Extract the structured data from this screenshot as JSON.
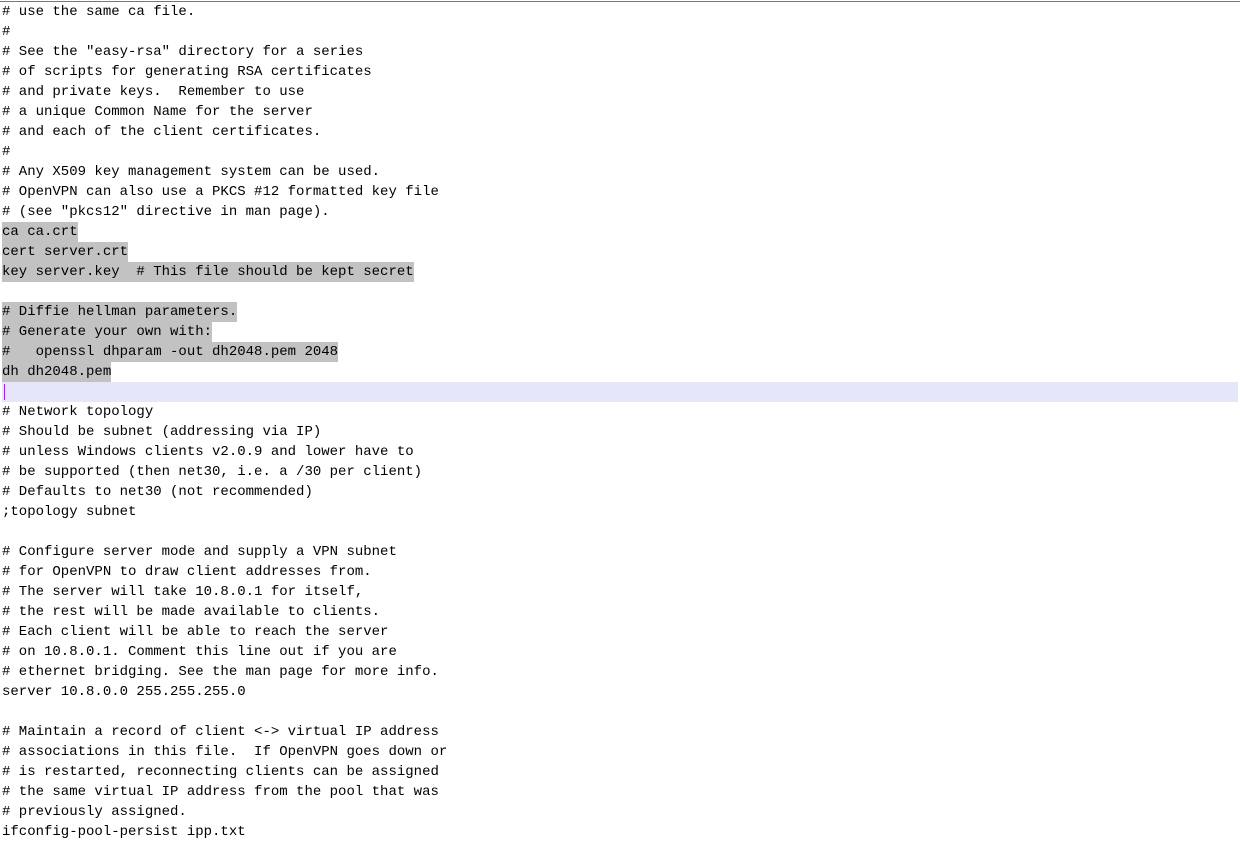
{
  "lines": [
    {
      "text": "# use the same ca file.",
      "sel": false
    },
    {
      "text": "#",
      "sel": false
    },
    {
      "text": "# See the \"easy-rsa\" directory for a series",
      "sel": false
    },
    {
      "text": "# of scripts for generating RSA certificates",
      "sel": false
    },
    {
      "text": "# and private keys.  Remember to use",
      "sel": false
    },
    {
      "text": "# a unique Common Name for the server",
      "sel": false
    },
    {
      "text": "# and each of the client certificates.",
      "sel": false
    },
    {
      "text": "#",
      "sel": false
    },
    {
      "text": "# Any X509 key management system can be used.",
      "sel": false
    },
    {
      "text": "# OpenVPN can also use a PKCS #12 formatted key file",
      "sel": false
    },
    {
      "text": "# (see \"pkcs12\" directive in man page).",
      "sel": false
    },
    {
      "text": "ca ca.crt",
      "sel": true
    },
    {
      "text": "cert server.crt",
      "sel": true
    },
    {
      "text": "key server.key  # This file should be kept secret",
      "sel": true
    },
    {
      "text": "",
      "sel": true
    },
    {
      "text": "# Diffie hellman parameters.",
      "sel": true
    },
    {
      "text": "# Generate your own with:",
      "sel": true
    },
    {
      "text": "#   openssl dhparam -out dh2048.pem 2048",
      "sel": true
    },
    {
      "text": "dh dh2048.pem",
      "sel": true
    },
    {
      "text": "",
      "sel": false,
      "cursor": true
    },
    {
      "text": "# Network topology",
      "sel": false
    },
    {
      "text": "# Should be subnet (addressing via IP)",
      "sel": false
    },
    {
      "text": "# unless Windows clients v2.0.9 and lower have to",
      "sel": false
    },
    {
      "text": "# be supported (then net30, i.e. a /30 per client)",
      "sel": false
    },
    {
      "text": "# Defaults to net30 (not recommended)",
      "sel": false
    },
    {
      "text": ";topology subnet",
      "sel": false
    },
    {
      "text": "",
      "sel": false
    },
    {
      "text": "# Configure server mode and supply a VPN subnet",
      "sel": false
    },
    {
      "text": "# for OpenVPN to draw client addresses from.",
      "sel": false
    },
    {
      "text": "# The server will take 10.8.0.1 for itself,",
      "sel": false
    },
    {
      "text": "# the rest will be made available to clients.",
      "sel": false
    },
    {
      "text": "# Each client will be able to reach the server",
      "sel": false
    },
    {
      "text": "# on 10.8.0.1. Comment this line out if you are",
      "sel": false
    },
    {
      "text": "# ethernet bridging. See the man page for more info.",
      "sel": false
    },
    {
      "text": "server 10.8.0.0 255.255.255.0",
      "sel": false
    },
    {
      "text": "",
      "sel": false
    },
    {
      "text": "# Maintain a record of client <-> virtual IP address",
      "sel": false
    },
    {
      "text": "# associations in this file.  If OpenVPN goes down or",
      "sel": false
    },
    {
      "text": "# is restarted, reconnecting clients can be assigned",
      "sel": false
    },
    {
      "text": "# the same virtual IP address from the pool that was",
      "sel": false
    },
    {
      "text": "# previously assigned.",
      "sel": false
    },
    {
      "text": "ifconfig-pool-persist ipp.txt",
      "sel": false
    },
    {
      "text": "",
      "sel": false
    }
  ]
}
